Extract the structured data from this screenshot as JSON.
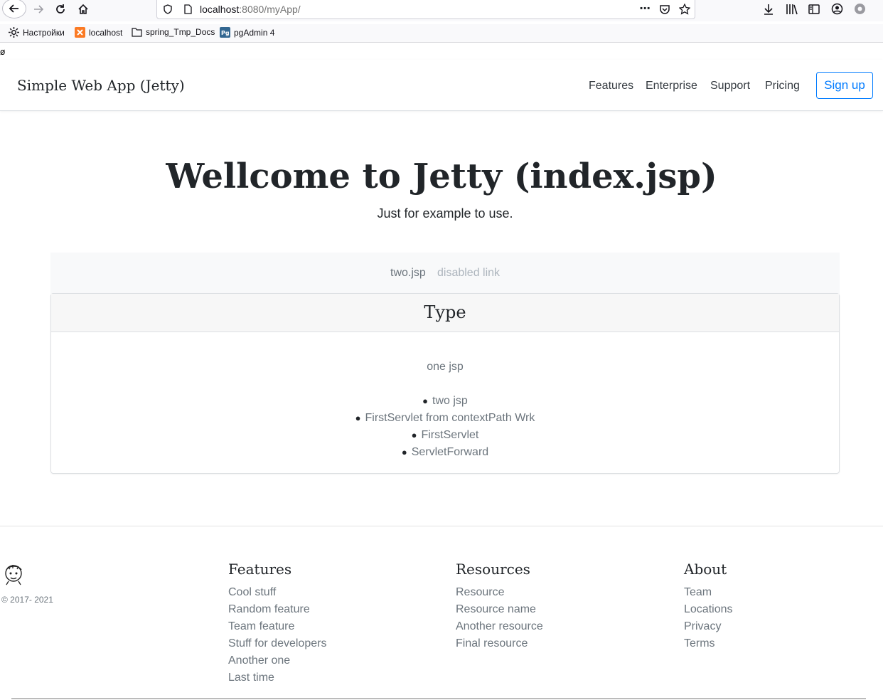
{
  "browser": {
    "url_host": "localhost",
    "url_path": ":8080/myApp/",
    "bookmarks": [
      "Настройки",
      "localhost",
      "spring_Tmp_Docs",
      "pgAdmin 4"
    ]
  },
  "stray_char": "ø",
  "header": {
    "brand": "Simple Web App (Jetty)",
    "links": [
      "Features",
      "Enterprise",
      "Support",
      "Pricing"
    ],
    "signup": "Sign up"
  },
  "hero": {
    "title": "Wellcome to Jetty (index.jsp)",
    "subtitle": "Just for example to use."
  },
  "nav_strip": {
    "link": "two.jsp",
    "disabled": "disabled link"
  },
  "card": {
    "title": "Type",
    "first_line": "one jsp",
    "items": [
      "two jsp",
      "FirstServlet from contextPath Wrk",
      "FirstServlet",
      "ServletForward"
    ]
  },
  "footer": {
    "copyright": "© 2017- 2021",
    "columns": [
      {
        "title": "Features",
        "links": [
          "Cool stuff",
          "Random feature",
          "Team feature",
          "Stuff for developers",
          "Another one",
          "Last time"
        ]
      },
      {
        "title": "Resources",
        "links": [
          "Resource",
          "Resource name",
          "Another resource",
          "Final resource"
        ]
      },
      {
        "title": "About",
        "links": [
          "Team",
          "Locations",
          "Privacy",
          "Terms"
        ]
      }
    ]
  },
  "colors": {
    "accent": "#007bff",
    "muted": "#6c757d",
    "disabled": "#adb5bd"
  }
}
